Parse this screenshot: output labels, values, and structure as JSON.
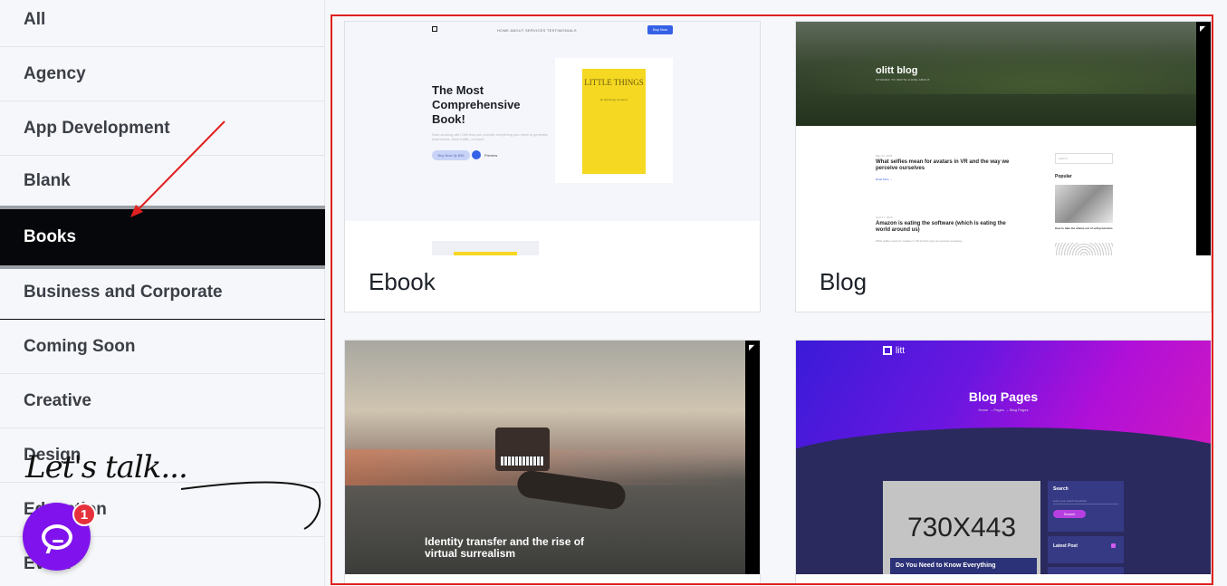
{
  "sidebar": {
    "categories": [
      {
        "label": "All"
      },
      {
        "label": "Agency"
      },
      {
        "label": "App Development"
      },
      {
        "label": "Blank"
      },
      {
        "label": "Books"
      },
      {
        "label": "Business and Corporate"
      },
      {
        "label": "Coming Soon"
      },
      {
        "label": "Creative"
      },
      {
        "label": "Design"
      },
      {
        "label": "Education"
      },
      {
        "label": "Event"
      }
    ],
    "active": "Books"
  },
  "templates": [
    {
      "label": "Ebook",
      "preview": {
        "nav_links": "HOME     ABOUT     SERVICES     TESTIMONIALS",
        "nav_button": "Buy Now",
        "heading": "The Most Comprehensive Book!",
        "body": "Start working with Olitt that can provide everything you need to generate awareness, drive traffic, connect.",
        "buy_label": "Buy Now @ $36",
        "preview_label": "Preview",
        "book_title": "LITTLE THINGS",
        "book_subtitle": "an anthology of poems"
      }
    },
    {
      "label": "Blog",
      "preview": {
        "brand": "olitt blog",
        "tagline": "STORIES TO WRITE HOME ABOUT",
        "post1_date": "May 21, 2018",
        "post1_title": "What selfies mean for avatars in VR and the way we perceive ourselves",
        "post1_read": "Read More →",
        "post2_date": "April 17, 2019",
        "post2_title": "Amazon is eating the software (which is eating the world around us)",
        "post2_text": "What selfies mean for avatars in VR and the way we perceive ourselves",
        "search": "Search...",
        "popular": "Popular",
        "popular_caption": "How to take the shame out of self-promotion"
      }
    },
    {
      "label": "",
      "preview": {
        "title": "Identity transfer and the rise of virtual surrealism"
      }
    },
    {
      "label": "",
      "preview": {
        "brand": "litt",
        "title": "Blog Pages",
        "breadcrumb": "Home  →  Pages  →  Blog Pages",
        "placeholder": "730X443",
        "post_title": "Do You Need to Know Everything",
        "search_label": "Search",
        "search_placeholder": "enter your search keywords",
        "search_button": "Search",
        "latest_post": "Latest Post"
      }
    }
  ],
  "chat_widget": {
    "script_text": "Let's talk...",
    "badge_count": "1"
  },
  "colors": {
    "active_bg": "#06070b",
    "highlight_border": "#e02020",
    "chat_purple": "#8013ed",
    "badge_red": "#e5313c"
  }
}
